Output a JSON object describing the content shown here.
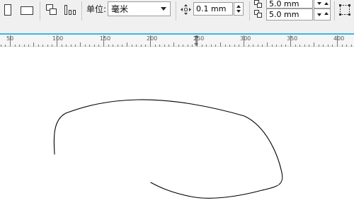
{
  "toolbar": {
    "unit_label": "单位:",
    "unit_value": "毫米",
    "nudge_value": "0.1 mm",
    "dup_x_value": "5.0 mm",
    "dup_y_value": "5.0 mm"
  },
  "ruler": {
    "labels": [
      "50",
      "100",
      "150",
      "200",
      "250",
      "300",
      "350",
      "400"
    ]
  },
  "colors": {
    "accent_line": "#38b8e8",
    "curve": "#000000"
  }
}
